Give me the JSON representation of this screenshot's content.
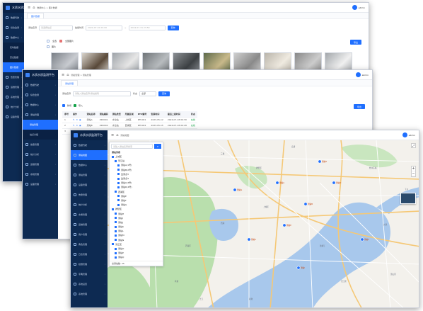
{
  "app": {
    "title": "水质水质监测平台"
  },
  "user": {
    "name": "admin"
  },
  "colors": {
    "sidebar": "#0d2a52",
    "accent": "#1f6fff",
    "map_water": "#a8c8ec",
    "map_green": "#b9dfad"
  },
  "win1": {
    "breadcrumb": "数据中心 > 图片数据",
    "tab": "图片数据",
    "menu": [
      {
        "label": "数据驾驶",
        "icon": "dashboard-icon"
      },
      {
        "label": "综合监测",
        "icon": "monitor-icon"
      },
      {
        "label": "数据中心",
        "icon": "data-icon"
      },
      {
        "label": "实时数据",
        "sub": true
      },
      {
        "label": "历史数据",
        "sub": true
      },
      {
        "label": "图片数据",
        "sub": true,
        "active": true
      },
      {
        "label": "告警管理",
        "icon": "alarm-icon"
      },
      {
        "label": "运维管理",
        "icon": "tool-icon"
      },
      {
        "label": "系统管理",
        "icon": "gear-icon"
      },
      {
        "label": "统计分析",
        "icon": "chart-icon"
      },
      {
        "label": "设备管理",
        "icon": "device-icon"
      }
    ],
    "filters": {
      "station_label": "测站名称",
      "station_placeholder": "请选择站点",
      "time_label": "拍摄时间",
      "start": "2024-07-01 00:00",
      "end": "2024-07-31 23:59",
      "search": "查询"
    },
    "checks": {
      "all": "全选",
      "picked": "全部图片",
      "label": "图片"
    },
    "export": "导出"
  },
  "win2": {
    "breadcrumb": "测站管理 > 测站管理",
    "tab": "测站管理",
    "menu": [
      {
        "label": "数据驾驶",
        "icon": "dashboard-icon"
      },
      {
        "label": "综合监测",
        "icon": "monitor-icon"
      },
      {
        "label": "数据中心",
        "icon": "data-icon"
      },
      {
        "label": "测站管理",
        "icon": "station-icon"
      },
      {
        "label": "测站管理",
        "sub": true,
        "active": true
      },
      {
        "label": "站点分组",
        "sub": true
      },
      {
        "label": "告警管理",
        "icon": "alarm-icon"
      },
      {
        "label": "统计分析",
        "icon": "chart-icon"
      },
      {
        "label": "运维管理",
        "icon": "tool-icon"
      },
      {
        "label": "系统管理",
        "icon": "gear-icon"
      },
      {
        "label": "设备管理",
        "icon": "device-icon"
      }
    ],
    "filters": {
      "station_label": "测站名称",
      "station_placeholder": "请输入测站名称/测站编码",
      "status_label": "状态",
      "status_value": "全部",
      "search": "查询"
    },
    "actions": {
      "add": "新增",
      "import": "导入",
      "export": "导出"
    },
    "table": {
      "headers": [
        "序号",
        "操作",
        "测站名称",
        "测站编码",
        "测站类型",
        "所属区域",
        "RTU编号",
        "安装时间",
        "最后上报时间",
        "状态"
      ],
      "rows": [
        [
          "1",
          "",
          "测站A",
          "ZD0001",
          "水位站",
          "上城区",
          "RTU001",
          "2023-05-12",
          "2024-07-18 09:30",
          "在线"
        ],
        [
          "2",
          "",
          "测站B",
          "ZD0002",
          "水位站",
          "西湖区",
          "RTU002",
          "2023-05-15",
          "2024-07-18 09:28",
          "在线"
        ],
        [
          "3",
          "",
          "测站C",
          "ZD0003",
          "雨量站",
          "拱墅区",
          "RTU003",
          "2023-06-01",
          "2024-07-18 09:25",
          "在线"
        ]
      ]
    }
  },
  "win3": {
    "breadcrumb": "测站地图",
    "menu": [
      {
        "label": "数据驾驶",
        "icon": "dashboard-icon"
      },
      {
        "label": "测站地图",
        "icon": "map-icon",
        "active": true
      },
      {
        "label": "数据中心",
        "icon": "data-icon"
      },
      {
        "label": "测站管理",
        "icon": "station-icon"
      },
      {
        "label": "设备管理",
        "icon": "device-icon"
      },
      {
        "label": "告警管理",
        "icon": "alarm-icon"
      },
      {
        "label": "统计分析",
        "icon": "chart-icon"
      },
      {
        "label": "水质管理",
        "icon": "water-icon"
      },
      {
        "label": "运维管理",
        "icon": "tool-icon"
      },
      {
        "label": "用户管理",
        "icon": "user-icon"
      },
      {
        "label": "角色管理",
        "icon": "role-icon"
      },
      {
        "label": "日志管理",
        "icon": "log-icon"
      },
      {
        "label": "权限管理",
        "icon": "lock-icon"
      },
      {
        "label": "字典管理",
        "icon": "book-icon"
      },
      {
        "label": "系统设置",
        "icon": "gear-icon"
      },
      {
        "label": "系统管理",
        "icon": "gear-icon"
      }
    ],
    "tree": {
      "search_placeholder": "请输入测站名称搜索",
      "title": "测站列表",
      "nodes": [
        {
          "label": "上城区",
          "level": 0
        },
        {
          "label": "望江站",
          "level": 1
        },
        {
          "label": "测站A(1号)",
          "level": 2
        },
        {
          "label": "测站B(2号)",
          "level": 2
        },
        {
          "label": "监测点3",
          "level": 2
        },
        {
          "label": "监测点4",
          "level": 2
        },
        {
          "label": "测站C(3号)",
          "level": 2
        },
        {
          "label": "测站D(4号)",
          "level": 2
        },
        {
          "label": "西湖区",
          "level": 1
        },
        {
          "label": "测站E",
          "level": 2
        },
        {
          "label": "测站F",
          "level": 2
        },
        {
          "label": "测站G",
          "level": 2
        },
        {
          "label": "拱墅区",
          "level": 0
        },
        {
          "label": "测站H",
          "level": 1
        },
        {
          "label": "测站I",
          "level": 1
        },
        {
          "label": "测站J",
          "level": 1
        },
        {
          "label": "测站K",
          "level": 1
        },
        {
          "label": "测站L",
          "level": 1
        },
        {
          "label": "测站M",
          "level": 1
        },
        {
          "label": "测站N",
          "level": 1
        },
        {
          "label": "滨江区",
          "level": 0
        },
        {
          "label": "测站O",
          "level": 1
        },
        {
          "label": "测站P",
          "level": 1
        },
        {
          "label": "测站Q",
          "level": 1
        },
        {
          "label": "测站R",
          "level": 1
        }
      ],
      "footer": "总测站数: 25"
    },
    "map_labels": [
      "西湖",
      "钱塘江",
      "滨江区",
      "上城区",
      "拱墅区",
      "萧山区",
      "西湖区",
      "杭州东站",
      "下沙",
      "九堡",
      "转塘",
      "之江",
      "闻堰",
      "三墩",
      "留下",
      "良渚"
    ],
    "poi_labels": [
      "测站A",
      "测站B",
      "测站C",
      "测站D",
      "测站E",
      "测站F",
      "测站G",
      "测站H",
      "测站I"
    ]
  }
}
